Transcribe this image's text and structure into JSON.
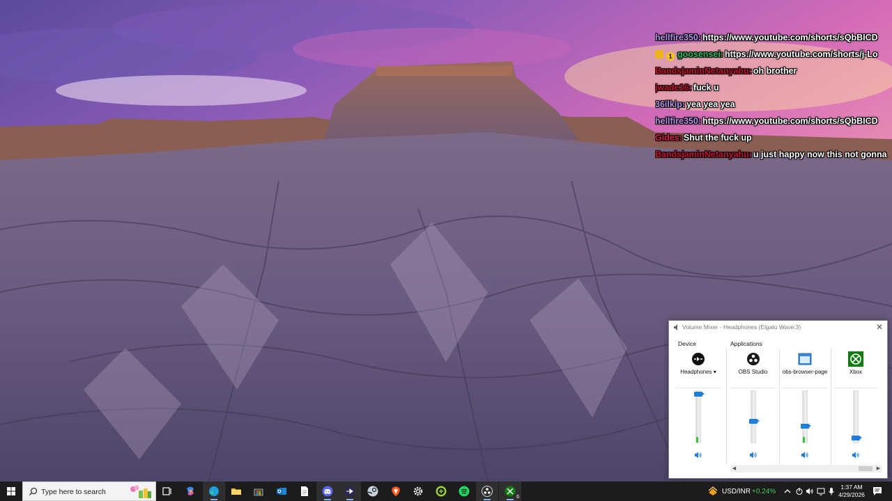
{
  "chat": {
    "lines": [
      {
        "user": "hellfire350:",
        "message": "https://www.youtube.com/shorts/sQbBICD",
        "color": "#b88fe8"
      },
      {
        "user": "goosensei:",
        "message": "https://www.youtube.com/shorts/j-Lo",
        "color": "#2ebd5b",
        "badge_count": "1"
      },
      {
        "user": "BandsjaminNetanyahu:",
        "message": "oh brother",
        "color": "#c8102e"
      },
      {
        "user": "jwade16:",
        "message": "fuck u",
        "color": "#c8102e"
      },
      {
        "user": "36ilkip:",
        "message": "yea yea yea",
        "color": "#b88fe8"
      },
      {
        "user": "hellfire350:",
        "message": "https://www.youtube.com/shorts/sQbBICD",
        "color": "#b88fe8"
      },
      {
        "user": "Gides:",
        "message": "Shut the fuck up",
        "color": "#e0204a"
      },
      {
        "user": "BandsjaminNetanyahu:",
        "message": "u just happy now this not gonna",
        "color": "#c8102e"
      }
    ]
  },
  "mixer": {
    "title": "Volume Mixer - Headphones (Elgato Wave:3)",
    "device_label": "Device",
    "applications_label": "Applications",
    "device": {
      "name": "Headphones",
      "level": 0.97,
      "meter": 0.1
    },
    "apps": [
      {
        "name": "OBS Studio",
        "level": 0.4,
        "meter": 0.0
      },
      {
        "name": "obs-browser-page",
        "level": 0.31,
        "meter": 0.1
      },
      {
        "name": "Xbox",
        "level": 0.06,
        "meter": 0.0
      }
    ],
    "accent": "#1f7fd8"
  },
  "taskbar": {
    "search_placeholder": "Type here to search",
    "apps": [
      "task-view",
      "copilot",
      "edge",
      "file-explorer",
      "microsoft-store",
      "outlook",
      "notepad",
      "discord",
      "obs-studio",
      "steam",
      "brave",
      "settings",
      "xbox-controller",
      "spotify",
      "obs-studio-2",
      "xbox"
    ],
    "xbox_count": "6",
    "ticker": {
      "symbol": "USD/INR",
      "change": "+0.24%",
      "change_color": "#3ecf5b"
    },
    "clock": {
      "time": "1:37 AM",
      "date": "4/29/2026"
    }
  }
}
